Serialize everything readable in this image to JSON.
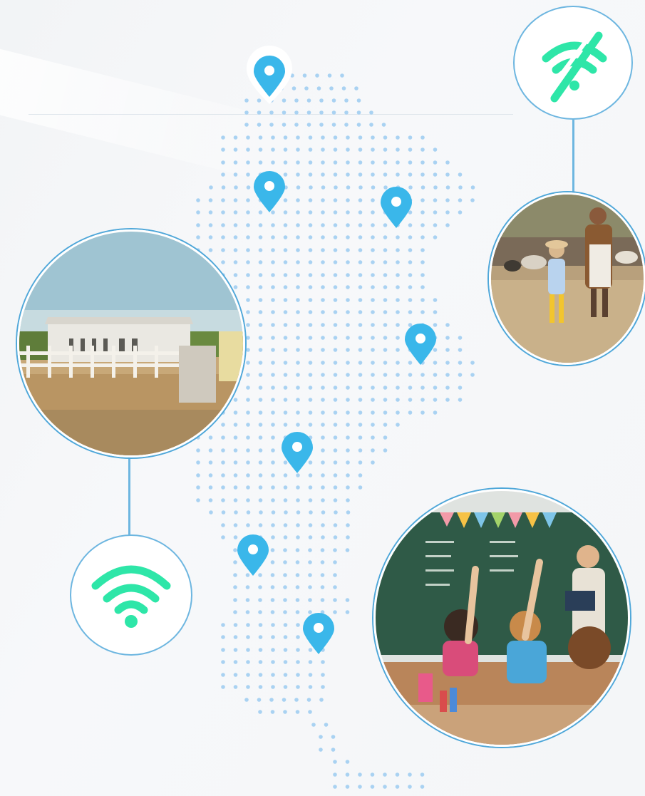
{
  "theme": {
    "dot_color": "#a9d2f2",
    "pin_color": "#3ab7ea",
    "ring_color": "#4fa7d9",
    "wifi_color": "#2ee6a8"
  },
  "illustration": {
    "subject": "country-map-connectivity",
    "pins": [
      {
        "id": "pin-1"
      },
      {
        "id": "pin-2"
      },
      {
        "id": "pin-3"
      },
      {
        "id": "pin-4"
      },
      {
        "id": "pin-5"
      },
      {
        "id": "pin-6"
      },
      {
        "id": "pin-7"
      }
    ],
    "photos": [
      {
        "id": "photo-rural-building",
        "icon": "farm-building-photo"
      },
      {
        "id": "photo-child-and-adult-walking",
        "icon": "people-walking-photo"
      },
      {
        "id": "photo-classroom",
        "icon": "classroom-photo"
      }
    ],
    "badges": [
      {
        "id": "wifi-off-badge",
        "icon": "wifi-off-icon"
      },
      {
        "id": "wifi-on-badge",
        "icon": "wifi-icon"
      }
    ]
  }
}
